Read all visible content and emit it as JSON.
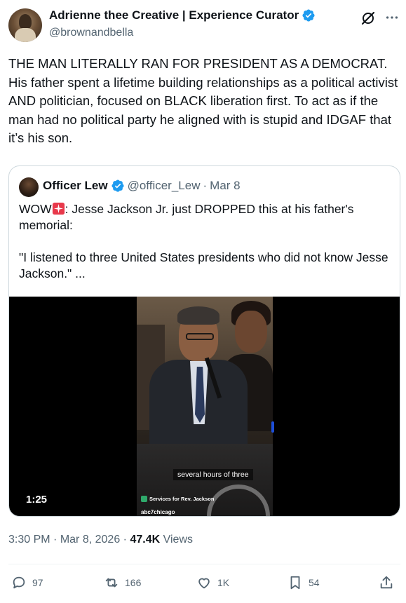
{
  "author": {
    "display_name": "Adrienne thee Creative | Experience Curator",
    "handle": "@brownandbella"
  },
  "tweet": {
    "text": "THE MAN LITERALLY RAN FOR PRESIDENT AS A DEMOCRAT. His father spent a lifetime building relationships as a political activist AND politician, focused on BLACK liberation first. To act as if the man had no political party he aligned with is stupid and IDGAF that it’s his son."
  },
  "quote": {
    "display_name": "Officer Lew",
    "handle": "@officer_Lew",
    "separator": "·",
    "date": "Mar 8",
    "text_prefix": "WOW",
    "text_line1": ":  Jesse Jackson Jr. just DROPPED this at his father's memorial:",
    "text_line2": "\"I listened to three United States presidents who did not know Jesse Jackson.\"  ...",
    "video": {
      "caption": "several hours of three",
      "lower_third": "Services for Rev. Jackson",
      "channel": "abc7chicago",
      "duration": "1:25"
    }
  },
  "meta": {
    "time": "3:30 PM",
    "separator": "·",
    "date": "Mar 8, 2026",
    "views_count": "47.4K",
    "views_label": "Views"
  },
  "actions": {
    "replies": "97",
    "reposts": "166",
    "likes": "1K",
    "bookmarks": "54"
  },
  "colors": {
    "accent": "#1d9bf0",
    "text": "#0f1419",
    "muted": "#536471",
    "border": "#cfd9de"
  }
}
